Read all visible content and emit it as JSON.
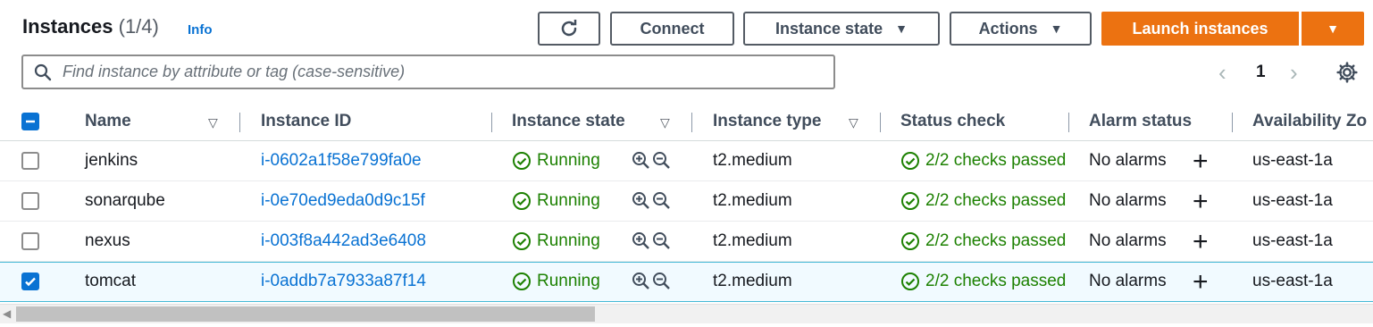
{
  "header": {
    "title": "Instances",
    "count": "(1/4)",
    "info": "Info"
  },
  "toolbar": {
    "refresh_icon": "refresh-icon",
    "connect": "Connect",
    "instance_state": "Instance state",
    "actions": "Actions",
    "launch": "Launch instances",
    "caret": "▼"
  },
  "search": {
    "placeholder": "Find instance by attribute or tag (case-sensitive)"
  },
  "pagination": {
    "prev": "‹",
    "page": "1",
    "next": "›"
  },
  "columns": {
    "name": "Name",
    "instance_id": "Instance ID",
    "instance_state": "Instance state",
    "instance_type": "Instance type",
    "status_check": "Status check",
    "alarm_status": "Alarm status",
    "availability_zone": "Availability Zo"
  },
  "rows": [
    {
      "name": "jenkins",
      "id": "i-0602a1f58e799fa0e",
      "state": "Running",
      "type": "t2.medium",
      "status": "2/2 checks passed",
      "alarm": "No alarms",
      "az": "us-east-1a",
      "selected": false
    },
    {
      "name": "sonarqube",
      "id": "i-0e70ed9eda0d9c15f",
      "state": "Running",
      "type": "t2.medium",
      "status": "2/2 checks passed",
      "alarm": "No alarms",
      "az": "us-east-1a",
      "selected": false
    },
    {
      "name": "nexus",
      "id": "i-003f8a442ad3e6408",
      "state": "Running",
      "type": "t2.medium",
      "status": "2/2 checks passed",
      "alarm": "No alarms",
      "az": "us-east-1a",
      "selected": false
    },
    {
      "name": "tomcat",
      "id": "i-0addb7a7933a87f14",
      "state": "Running",
      "type": "t2.medium",
      "status": "2/2 checks passed",
      "alarm": "No alarms",
      "az": "us-east-1a",
      "selected": true
    }
  ],
  "colors": {
    "accent": "#ec7211",
    "link": "#0972d3",
    "success": "#1d8102",
    "selected_bg": "#f1faff"
  }
}
